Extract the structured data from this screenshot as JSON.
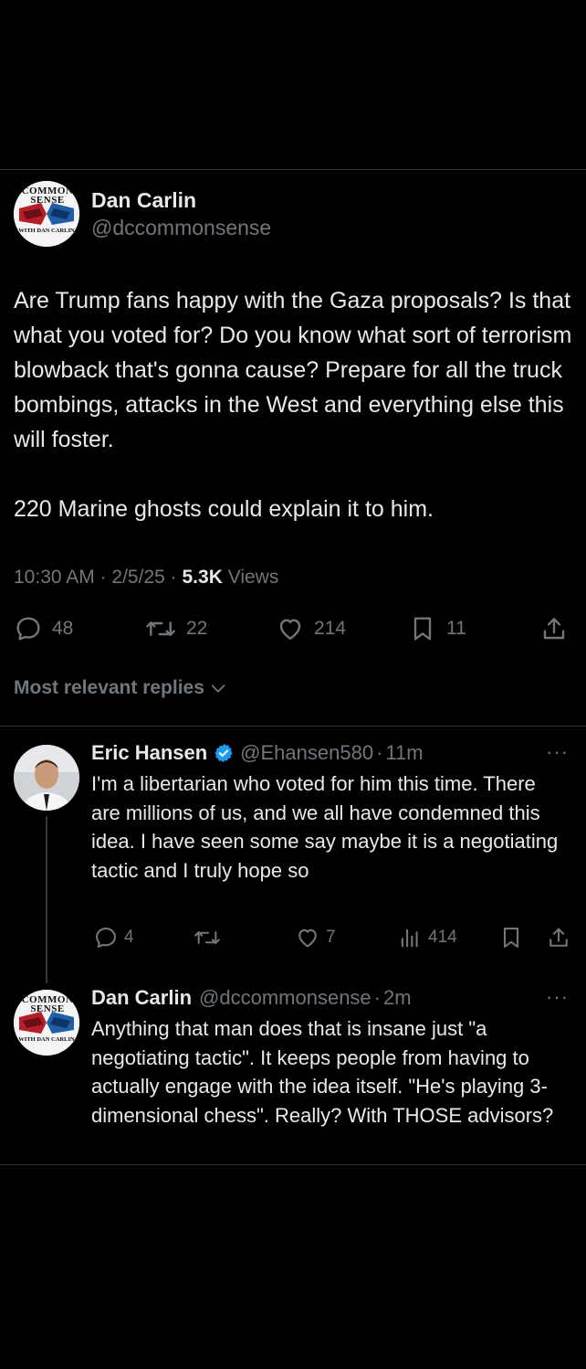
{
  "tweet": {
    "author_name": "Dan Carlin",
    "author_handle": "@dccommonsense",
    "avatar_text_top": "COMMON SENSE",
    "avatar_text_bottom": "WITH DAN CARLIN",
    "paragraph1": "Are Trump fans happy with the Gaza proposals? Is that what you voted for? Do you know what sort of terrorism blowback that's gonna cause? Prepare for all the truck bombings, attacks in the West and everything else this will foster.",
    "paragraph2": "220 Marine ghosts could explain it to him.",
    "time": "10:30 AM",
    "date": "2/5/25",
    "views_count": "5.3K",
    "views_label": "Views",
    "replies": "48",
    "retweets": "22",
    "likes": "214",
    "bookmarks": "11"
  },
  "sort_label": "Most relevant replies",
  "replies": [
    {
      "author_name": "Eric Hansen",
      "author_handle": "@Ehansen580",
      "time": "11m",
      "text": "I'm a libertarian who voted for him this time. There are millions of us, and we all have condemned this idea. I have seen some say maybe it is a negotiating tactic and I truly hope so",
      "replies": "4",
      "likes": "7",
      "views": "414",
      "verified_color": "#1d9bf0"
    },
    {
      "author_name": "Dan Carlin",
      "author_handle": "@dccommonsense",
      "time": "2m",
      "text": "Anything that man does that is insane just \"a negotiating tactic\". It keeps people from having to actually engage with the idea itself.  \"He's playing 3-dimensional chess\". Really? With THOSE advisors?"
    }
  ],
  "separator": "·",
  "more_glyph": "···",
  "colors": {
    "background": "#000000",
    "text": "#e7e9ea",
    "muted": "#71767b",
    "verified": "#1d9bf0",
    "divider": "#2f3336"
  }
}
